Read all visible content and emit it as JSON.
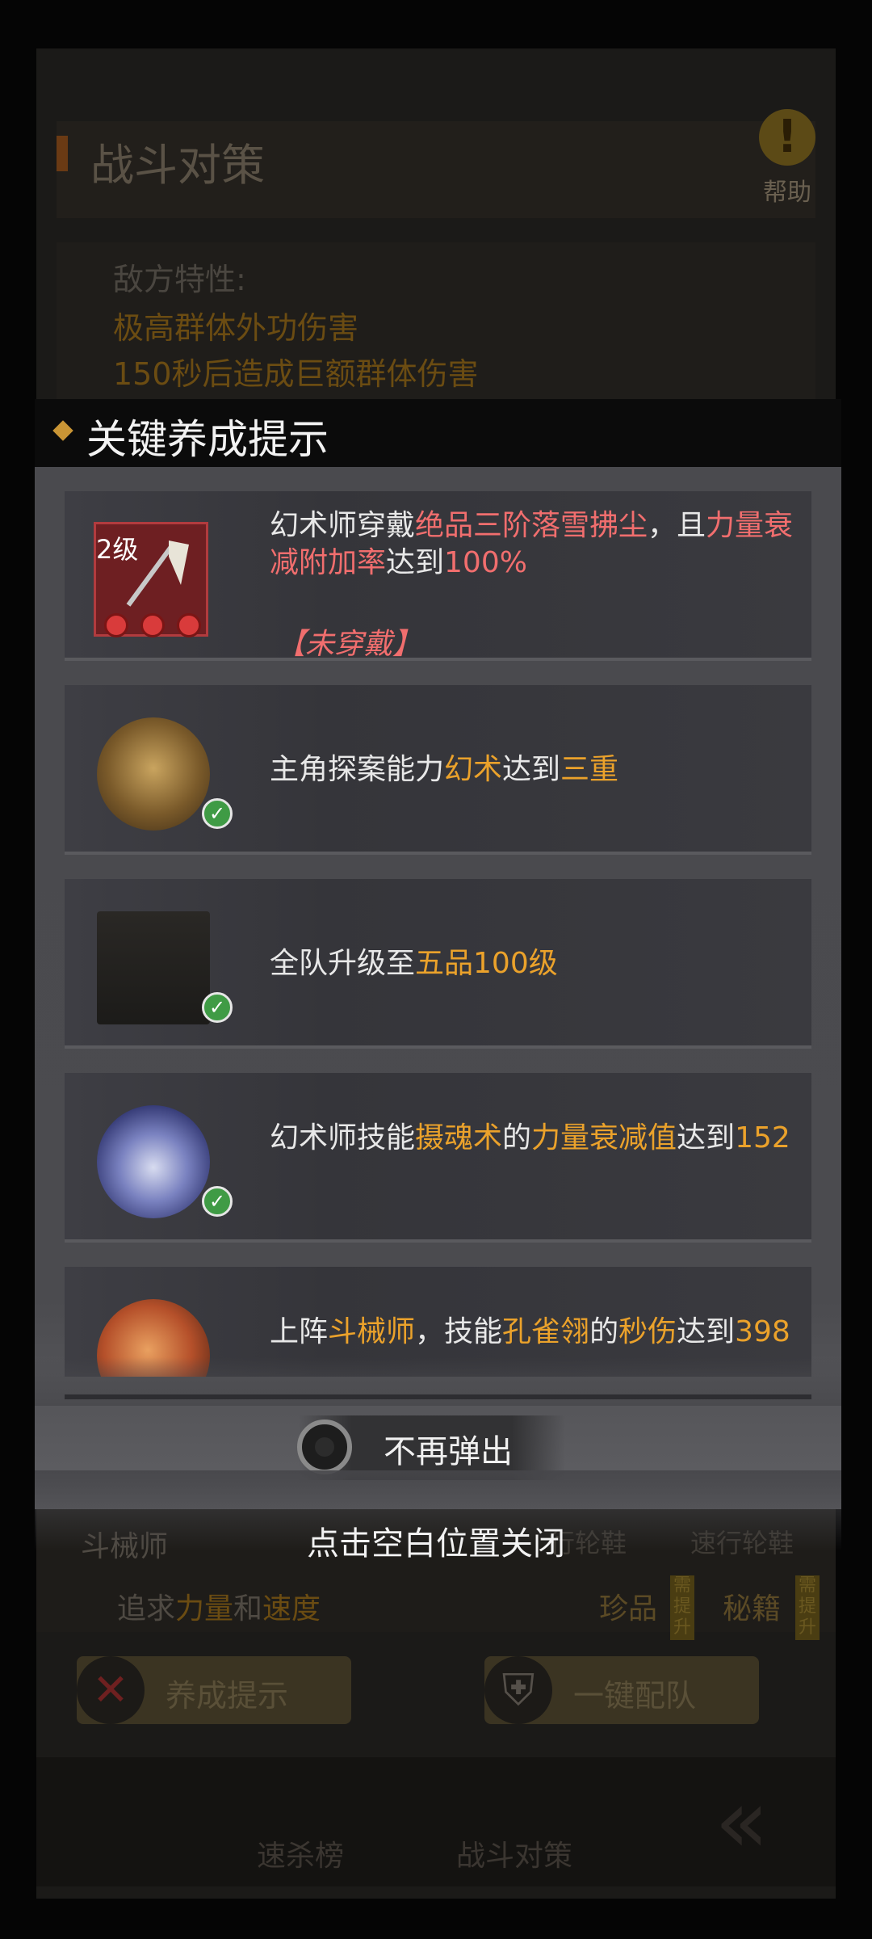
{
  "background": {
    "title": "战斗对策",
    "help_label": "帮助",
    "enemy_traits": {
      "heading": "敌方特性:",
      "lines": [
        "极高群体外功伤害",
        "150秒后造成巨额群体伤害"
      ]
    },
    "role": "斗械师",
    "pursue": {
      "prefix": "追求",
      "a": "力量",
      "mid": "和",
      "b": "速度"
    },
    "right_tags": [
      "行轮鞋",
      "速行轮鞋"
    ],
    "treasure": "珍品",
    "secret": "秘籍",
    "vertical_tag": "需提升",
    "buttons": {
      "develop_tip": "养成提示",
      "auto_team": "一键配队"
    },
    "nav": [
      "速杀榜",
      "战斗对策"
    ]
  },
  "modal": {
    "title": "关键养成提示",
    "cards": [
      {
        "icon_label": "2级",
        "segments": [
          {
            "t": "幻术师穿戴",
            "c": ""
          },
          {
            "t": "绝品三阶落雪拂尘",
            "c": "red"
          },
          {
            "t": "，且",
            "c": ""
          },
          {
            "t": "力量衰减附加率",
            "c": "red"
          },
          {
            "t": "达到",
            "c": ""
          },
          {
            "t": "100%",
            "c": "red"
          }
        ],
        "status": "【未穿戴】"
      },
      {
        "segments": [
          {
            "t": "主角探案能力",
            "c": ""
          },
          {
            "t": "幻术",
            "c": "orange"
          },
          {
            "t": "达到",
            "c": ""
          },
          {
            "t": "三重",
            "c": "orange"
          }
        ]
      },
      {
        "segments": [
          {
            "t": "全队升级至",
            "c": ""
          },
          {
            "t": "五品100级",
            "c": "orange"
          }
        ]
      },
      {
        "segments": [
          {
            "t": "幻术师技能",
            "c": ""
          },
          {
            "t": "摄魂术",
            "c": "orange"
          },
          {
            "t": "的",
            "c": ""
          },
          {
            "t": "力量衰减值",
            "c": "orange"
          },
          {
            "t": "达到",
            "c": ""
          },
          {
            "t": "152",
            "c": "orange"
          }
        ]
      },
      {
        "segments": [
          {
            "t": "上阵",
            "c": ""
          },
          {
            "t": "斗械师",
            "c": "orange"
          },
          {
            "t": "，技能",
            "c": ""
          },
          {
            "t": "孔雀翎",
            "c": "orange"
          },
          {
            "t": "的",
            "c": ""
          },
          {
            "t": "秒伤",
            "c": "orange"
          },
          {
            "t": "达到",
            "c": ""
          },
          {
            "t": "398",
            "c": "orange"
          }
        ]
      }
    ],
    "no_popup_label": "不再弹出",
    "close_hint": "点击空白位置关闭"
  },
  "colors": {
    "highlight_red": "#f16e6e",
    "highlight_orange": "#eba22b",
    "check_green": "#3f9b45"
  }
}
